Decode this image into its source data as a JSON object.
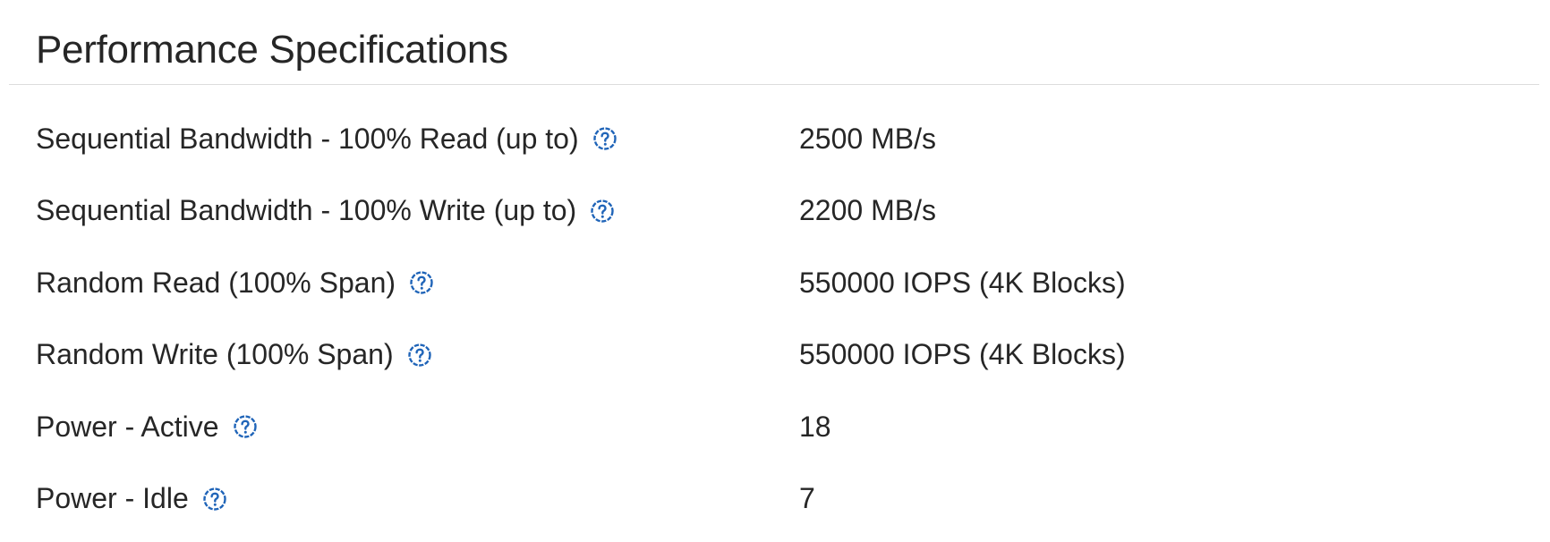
{
  "section": {
    "title": "Performance Specifications"
  },
  "colors": {
    "text": "#262626",
    "accent": "#1f64b8",
    "divider": "#dcdcdc"
  },
  "specs": [
    {
      "label": "Sequential Bandwidth - 100% Read (up to)",
      "value": "2500 MB/s",
      "help_icon": "question-circle-icon"
    },
    {
      "label": "Sequential Bandwidth - 100% Write (up to)",
      "value": "2200 MB/s",
      "help_icon": "question-circle-icon"
    },
    {
      "label": "Random Read (100% Span)",
      "value": "550000 IOPS (4K Blocks)",
      "help_icon": "question-circle-icon"
    },
    {
      "label": "Random Write (100% Span)",
      "value": "550000 IOPS (4K Blocks)",
      "help_icon": "question-circle-icon"
    },
    {
      "label": "Power - Active",
      "value": "18",
      "help_icon": "question-circle-icon"
    },
    {
      "label": "Power - Idle",
      "value": "7",
      "help_icon": "question-circle-icon"
    }
  ]
}
